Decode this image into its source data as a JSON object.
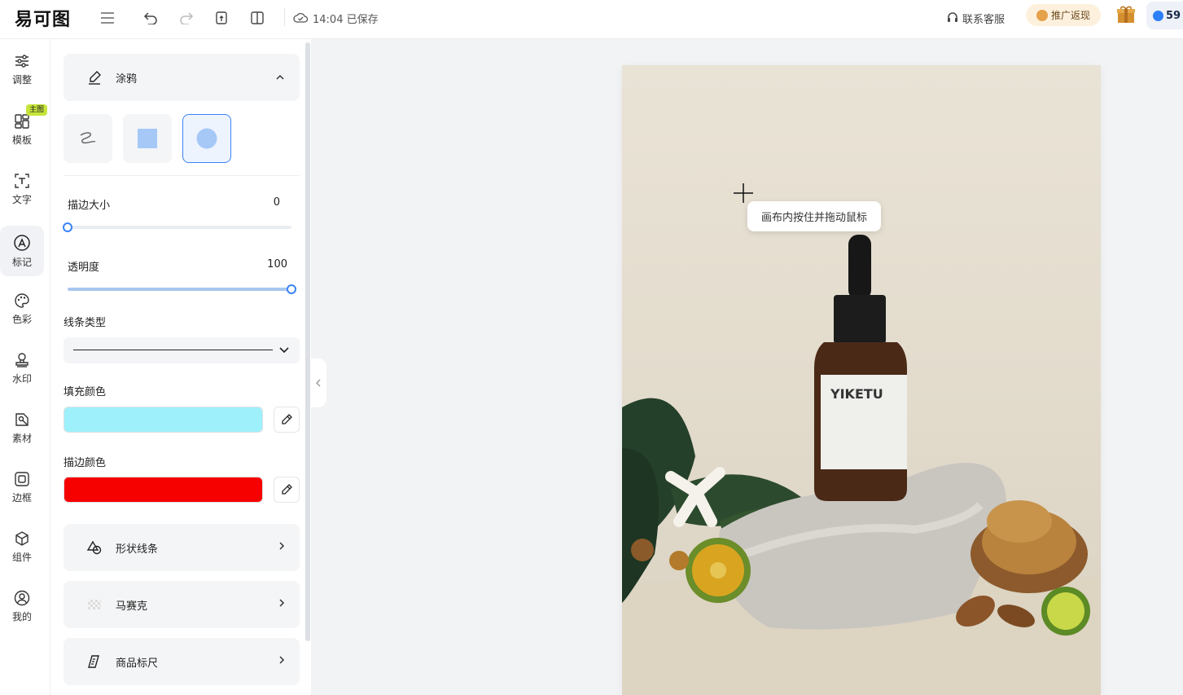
{
  "header": {
    "logo_text": "易可图",
    "save_status": "14:04 已保存",
    "contact_service": "联系客服",
    "promo_label": "推广返现",
    "credits_value": "59"
  },
  "leftnav": {
    "items": [
      {
        "label": "调整",
        "icon": "sliders-icon"
      },
      {
        "label": "模板",
        "icon": "template-grid-icon",
        "badge": "主图"
      },
      {
        "label": "文字",
        "icon": "text-icon"
      },
      {
        "label": "标记",
        "icon": "mark-icon"
      },
      {
        "label": "色彩",
        "icon": "palette-icon"
      },
      {
        "label": "水印",
        "icon": "stamp-icon"
      },
      {
        "label": "素材",
        "icon": "material-icon"
      },
      {
        "label": "边框",
        "icon": "frame-icon"
      },
      {
        "label": "组件",
        "icon": "cube-icon"
      },
      {
        "label": "我的",
        "icon": "user-icon"
      }
    ],
    "active": "标记"
  },
  "panel": {
    "doodle_title": "涂鸦",
    "stroke_size_label": "描边大小",
    "stroke_size_value": "0",
    "stroke_size_fraction": 0,
    "opacity_label": "透明度",
    "opacity_value": "100",
    "opacity_fraction": 1,
    "line_type_label": "线条类型",
    "fill_color_label": "填充颜色",
    "fill_color": "#9ef1fb",
    "stroke_color_label": "描边颜色",
    "stroke_color": "#f70000",
    "sections": [
      {
        "label": "形状线条",
        "icon": "shapes-icon"
      },
      {
        "label": "马赛克",
        "icon": "mosaic-icon"
      },
      {
        "label": "商品标尺",
        "icon": "ruler-icon"
      }
    ]
  },
  "canvas": {
    "product_brand": "YIKETU",
    "tooltip": "画布内按住并拖动鼠标"
  },
  "colors": {
    "accent": "#3b82f6",
    "shape_fill": "#a5c8f7"
  }
}
